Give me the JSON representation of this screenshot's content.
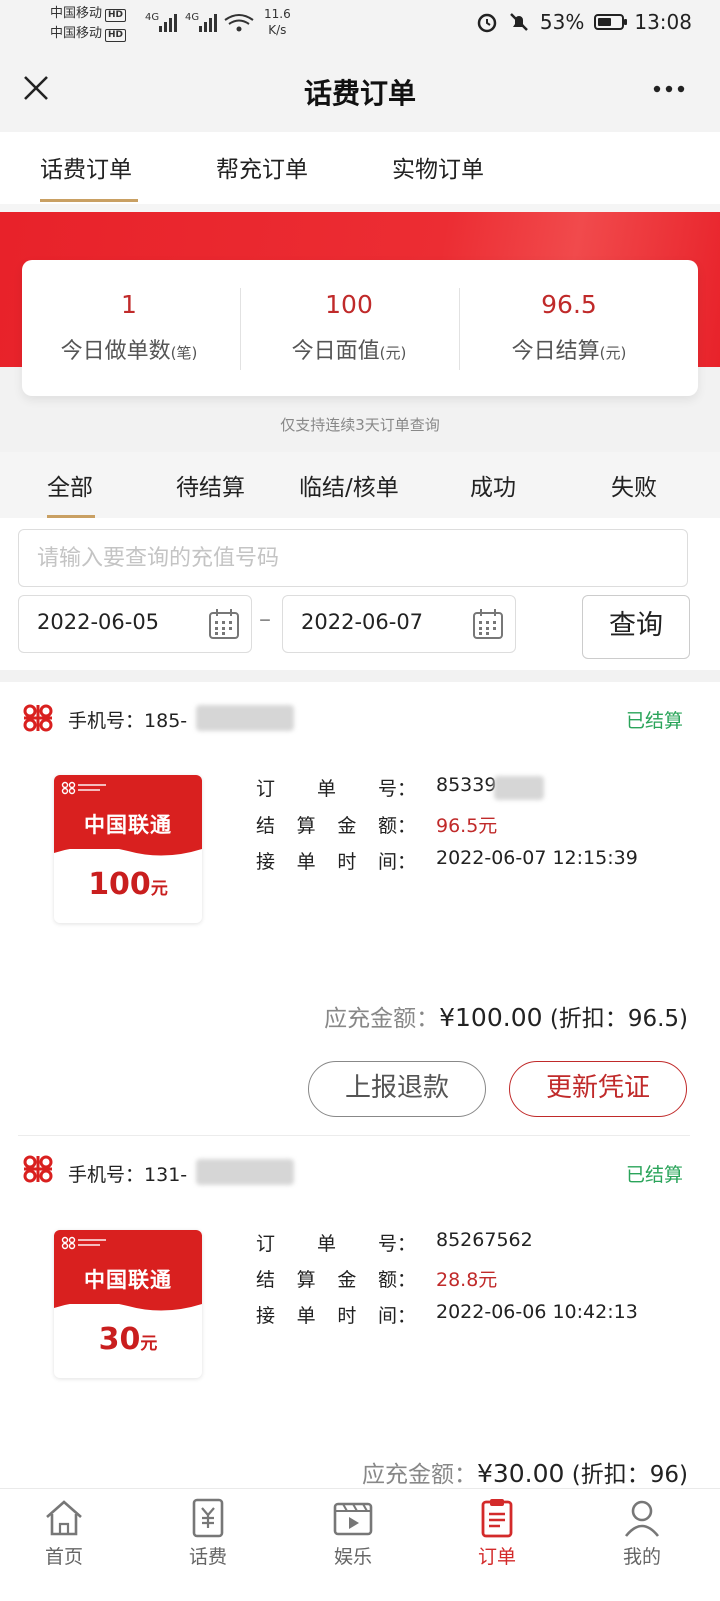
{
  "status_bar": {
    "carrier1": "中国移动",
    "carrier2": "中国移动",
    "hd": "HD",
    "net1": "4G",
    "net2": "4G",
    "speed_value": "11.6",
    "speed_unit": "K/s",
    "battery": "53%",
    "time": "13:08"
  },
  "nav": {
    "title": "话费订单"
  },
  "top_tabs": [
    {
      "label": "话费订单",
      "active": true
    },
    {
      "label": "帮充订单",
      "active": false
    },
    {
      "label": "实物订单",
      "active": false
    }
  ],
  "stats": [
    {
      "value": "1",
      "label": "今日做单数",
      "unit": "(笔)"
    },
    {
      "value": "100",
      "label": "今日面值",
      "unit": "(元)"
    },
    {
      "value": "96.5",
      "label": "今日结算",
      "unit": "(元)"
    }
  ],
  "note": "仅支持连续3天订单查询",
  "filter_tabs": [
    {
      "label": "全部",
      "active": true
    },
    {
      "label": "待结算",
      "active": false
    },
    {
      "label": "临结/核单",
      "active": false
    },
    {
      "label": "成功",
      "active": false
    },
    {
      "label": "失败",
      "active": false
    }
  ],
  "search": {
    "placeholder": "请输入要查询的充值号码",
    "value": "",
    "start_date": "2022-06-05",
    "end_date": "2022-06-07",
    "dash": "–",
    "query_label": "查询"
  },
  "labels": {
    "phone": "手机号：",
    "order_no": [
      "订",
      "单",
      "号："
    ],
    "settle_amount": [
      "结",
      "算",
      "金",
      "额："
    ],
    "time": [
      "接",
      "单",
      "时",
      "间："
    ],
    "due_amount": "应充金额：",
    "discount_open": "(折扣：",
    "refund_button": "上报退款",
    "update_button": "更新凭证"
  },
  "orders": [
    {
      "phone": "185-",
      "status": "已结算",
      "brand": "中国联通",
      "face_value": "100",
      "face_unit": "元",
      "order_no": "85339",
      "settle_amount": "96.5元",
      "time": "2022-06-07 12:15:39",
      "due_amount": "¥100.00",
      "discount": "96.5)"
    },
    {
      "phone": "131-",
      "status": "已结算",
      "brand": "中国联通",
      "face_value": "30",
      "face_unit": "元",
      "order_no": "85267562",
      "settle_amount": "28.8元",
      "time": "2022-06-06 10:42:13",
      "due_amount": "¥30.00",
      "discount": "96)"
    }
  ],
  "bottom_nav": [
    {
      "label": "首页",
      "icon": "home-icon",
      "active": false
    },
    {
      "label": "话费",
      "icon": "bill-icon",
      "active": false
    },
    {
      "label": "娱乐",
      "icon": "media-icon",
      "active": false
    },
    {
      "label": "订单",
      "icon": "order-icon",
      "active": true
    },
    {
      "label": "我的",
      "icon": "user-icon",
      "active": false
    }
  ],
  "colors": {
    "brand_red": "#e8222a",
    "accent_gold": "#c9a063",
    "success_green": "#2aa45a"
  }
}
